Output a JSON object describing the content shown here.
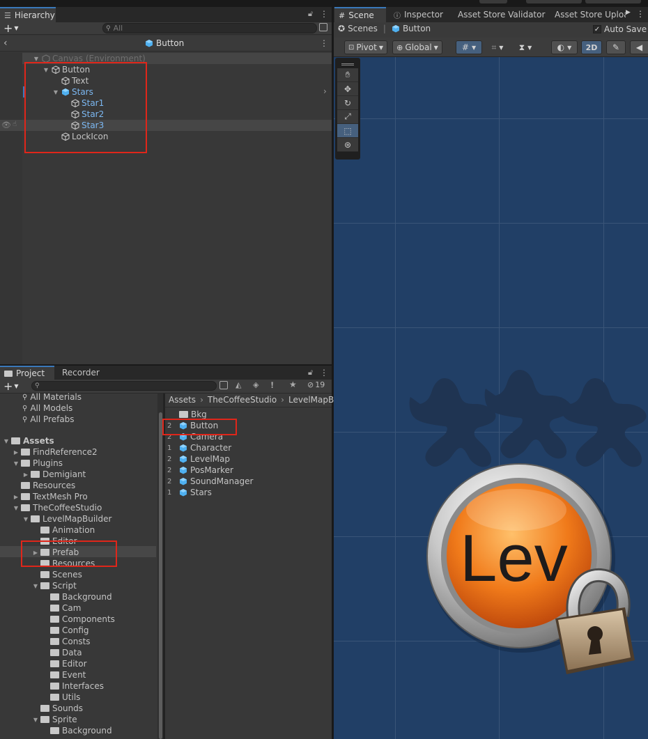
{
  "hierarchy": {
    "tab_label": "Hierarchy",
    "search_placeholder": "All",
    "prefab_title": "Button",
    "items": [
      {
        "label": "Canvas (Environment)"
      },
      {
        "label": "Button"
      },
      {
        "label": "Text"
      },
      {
        "label": "Stars"
      },
      {
        "label": "Star1"
      },
      {
        "label": "Star2"
      },
      {
        "label": "Star3"
      },
      {
        "label": "LockIcon"
      }
    ]
  },
  "scene_tabs": [
    "Scene",
    "Inspector",
    "Asset Store Validator",
    "Asset Store Uploa"
  ],
  "scene": {
    "breadcrumb_root": "Scenes",
    "breadcrumb_current": "Button",
    "auto_save_label": "Auto Save",
    "pivot_label": "Pivot",
    "global_label": "Global",
    "mode_2d_label": "2D",
    "button_text": "Lev",
    "colors": {
      "background": "#213f66",
      "grid": "#3a5578",
      "star": "#1f3452",
      "orange": "#e8620f"
    }
  },
  "project": {
    "tabs": [
      "Project",
      "Recorder"
    ],
    "hidden_count": "19",
    "search_placeholder": "",
    "favorites": [
      "All Materials",
      "All Models",
      "All Prefabs"
    ],
    "tree": [
      {
        "label": "Assets"
      },
      {
        "label": "FindReference2"
      },
      {
        "label": "Plugins"
      },
      {
        "label": "Demigiant"
      },
      {
        "label": "Resources"
      },
      {
        "label": "TextMesh Pro"
      },
      {
        "label": "TheCoffeeStudio"
      },
      {
        "label": "LevelMapBuilder"
      },
      {
        "label": "Animation"
      },
      {
        "label": "Editor"
      },
      {
        "label": "Prefab"
      },
      {
        "label": "Resources"
      },
      {
        "label": "Scenes"
      },
      {
        "label": "Script"
      },
      {
        "label": "Background"
      },
      {
        "label": "Cam"
      },
      {
        "label": "Components"
      },
      {
        "label": "Config"
      },
      {
        "label": "Consts"
      },
      {
        "label": "Data"
      },
      {
        "label": "Editor"
      },
      {
        "label": "Event"
      },
      {
        "label": "Interfaces"
      },
      {
        "label": "Utils"
      },
      {
        "label": "Sounds"
      },
      {
        "label": "Sprite"
      },
      {
        "label": "Background"
      }
    ],
    "breadcrumb": [
      "Assets",
      "TheCoffeeStudio",
      "LevelMapB"
    ],
    "assets": [
      {
        "count": "",
        "label": "Bkg",
        "type": "folder"
      },
      {
        "count": "2",
        "label": "Button",
        "type": "prefab"
      },
      {
        "count": "2",
        "label": "Camera",
        "type": "prefab"
      },
      {
        "count": "1",
        "label": "Character",
        "type": "prefab"
      },
      {
        "count": "2",
        "label": "LevelMap",
        "type": "prefab"
      },
      {
        "count": "2",
        "label": "PosMarker",
        "type": "prefab"
      },
      {
        "count": "2",
        "label": "SoundManager",
        "type": "prefab"
      },
      {
        "count": "1",
        "label": "Stars",
        "type": "prefab"
      }
    ]
  }
}
